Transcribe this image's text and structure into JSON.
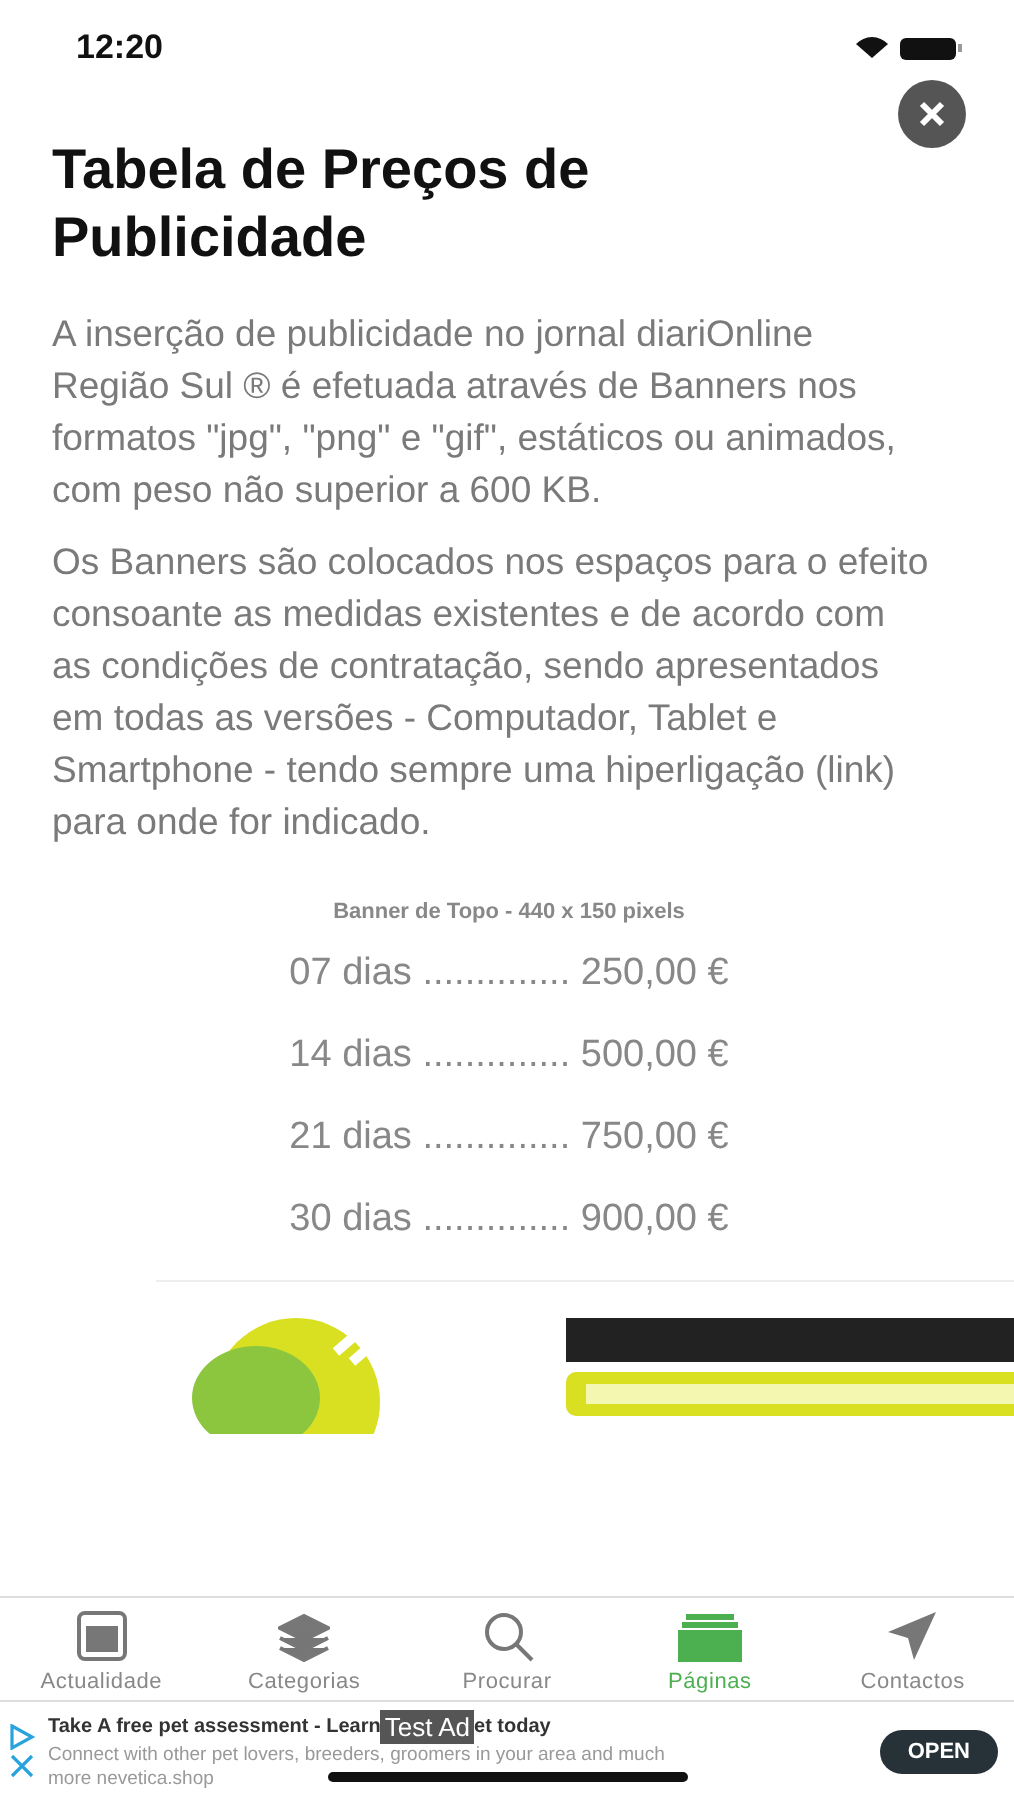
{
  "status_bar": {
    "time": "12:20"
  },
  "title": "Tabela de Preços de Publicidade",
  "paragraphs": [
    "A inserção de publicidade no jornal diariOnline Região Sul ® é efetuada através de Banners nos formatos \"jpg\", \"png\" e \"gif\", estáticos ou animados, com peso não superior a 600 KB.",
    "Os Banners são colocados nos espaços para o efeito consoante as medidas existentes e de acordo com as condições de contratação, sendo apresentados em todas as versões - Computador, Tablet e Smartphone - tendo sempre uma hiperligação (link) para onde for indicado."
  ],
  "price_table": {
    "caption": "Banner de Topo - 440 x 150 pixels",
    "rows": [
      {
        "text": "07 dias .............. 250,00 €"
      },
      {
        "text": "14 dias .............. 500,00 €"
      },
      {
        "text": "21 dias .............. 750,00 €"
      },
      {
        "text": "30 dias .............. 900,00 €"
      }
    ]
  },
  "tab_bar": [
    {
      "label": "Actualidade",
      "kind": "window",
      "selected": false
    },
    {
      "label": "Categorias",
      "kind": "layers",
      "selected": false
    },
    {
      "label": "Procurar",
      "kind": "search",
      "selected": false
    },
    {
      "label": "Páginas",
      "kind": "pages",
      "selected": true
    },
    {
      "label": "Contactos",
      "kind": "send",
      "selected": false
    }
  ],
  "ad": {
    "title_start": "Take A free pet assessment - Learn",
    "badge": "Test Ad",
    "title_end": "et today",
    "body_lines": [
      "Connect with other pet lovers, breeders, groomers in your area and much",
      "more nevetica.shop"
    ],
    "button": "OPEN"
  }
}
